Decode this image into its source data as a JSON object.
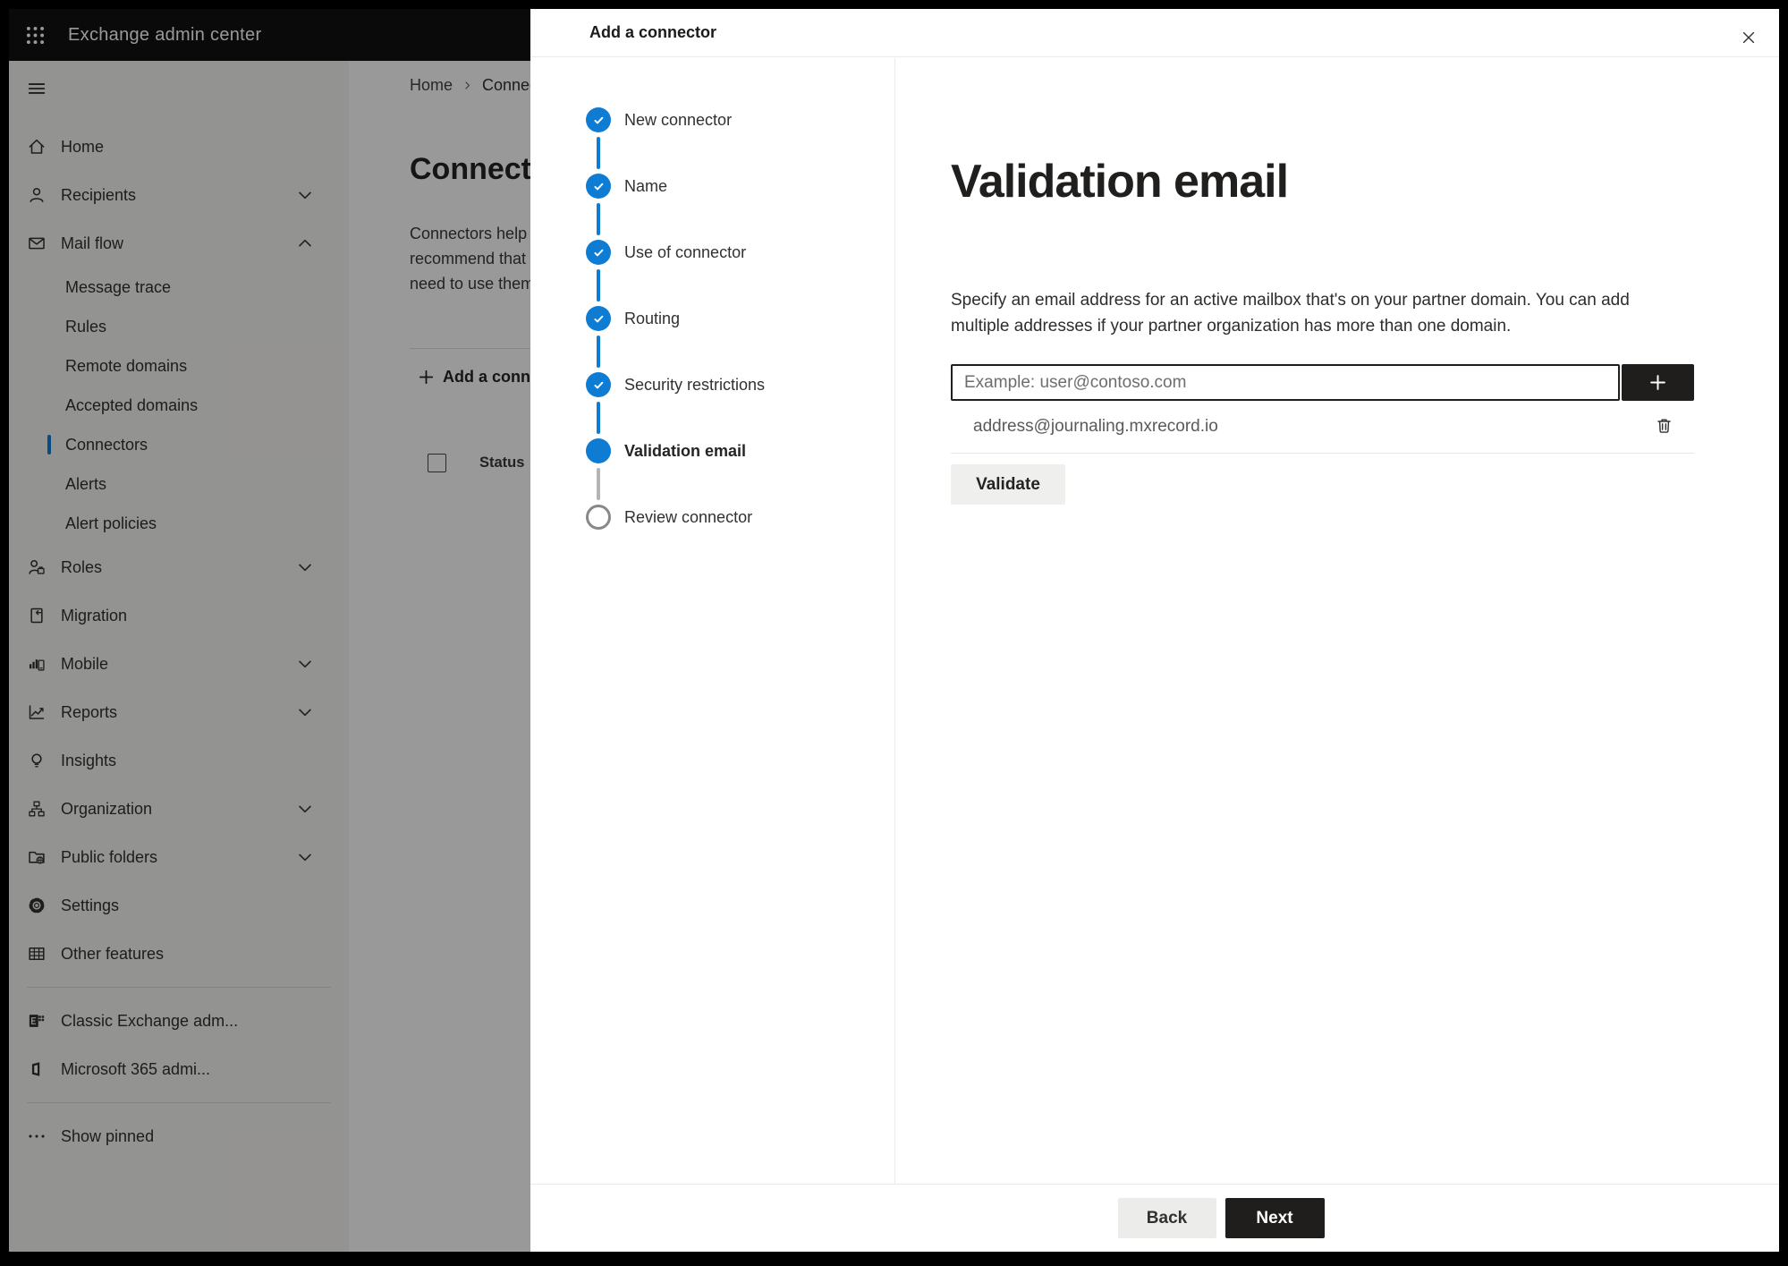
{
  "topbar": {
    "app_title": "Exchange admin center",
    "app_launcher_icon": "waffle"
  },
  "sidebar": {
    "menu_icon": "hamburger",
    "selected_item": "Connectors",
    "items": [
      {
        "label": "Home",
        "icon": "home"
      },
      {
        "label": "Recipients",
        "icon": "person",
        "chevron": "down"
      },
      {
        "label": "Mail flow",
        "icon": "mail",
        "chevron": "up",
        "children": [
          "Message trace",
          "Rules",
          "Remote domains",
          "Accepted domains",
          "Connectors",
          "Alerts",
          "Alert policies"
        ]
      },
      {
        "label": "Roles",
        "icon": "roles",
        "chevron": "down"
      },
      {
        "label": "Migration",
        "icon": "migration"
      },
      {
        "label": "Mobile",
        "icon": "mobile",
        "chevron": "down"
      },
      {
        "label": "Reports",
        "icon": "reports",
        "chevron": "down"
      },
      {
        "label": "Insights",
        "icon": "insights"
      },
      {
        "label": "Organization",
        "icon": "organization",
        "chevron": "down"
      },
      {
        "label": "Public folders",
        "icon": "public-folders",
        "chevron": "down"
      },
      {
        "label": "Settings",
        "icon": "gear"
      },
      {
        "label": "Other features",
        "icon": "table"
      },
      {
        "divider": true
      },
      {
        "label": "Classic Exchange adm...",
        "icon": "exchange-logo"
      },
      {
        "label": "Microsoft 365 admi...",
        "icon": "office-logo"
      },
      {
        "divider": true
      },
      {
        "label": "Show pinned",
        "icon": "ellipsis"
      }
    ]
  },
  "page": {
    "breadcrumb": {
      "home": "Home",
      "current": "Connectors",
      "separator_icon": "chevron-right"
    },
    "title": "Connectors",
    "description_lines": [
      "Connectors help",
      "recommend that",
      "need to use them"
    ],
    "add_button_label": "Add a connector",
    "add_button_icon": "plus",
    "table": {
      "status_column_label": "Status"
    }
  },
  "modal": {
    "title": "Add a connector",
    "close_icon": "close",
    "steps": [
      {
        "label": "New connector",
        "state": "complete"
      },
      {
        "label": "Name",
        "state": "complete"
      },
      {
        "label": "Use of connector",
        "state": "complete"
      },
      {
        "label": "Routing",
        "state": "complete"
      },
      {
        "label": "Security restrictions",
        "state": "complete"
      },
      {
        "label": "Validation email",
        "state": "current"
      },
      {
        "label": "Review connector",
        "state": "upcoming"
      }
    ],
    "content": {
      "heading": "Validation email",
      "description": "Specify an email address for an active mailbox that's on your partner domain. You can add multiple addresses if your partner organization has more than one domain.",
      "input_placeholder": "Example: user@contoso.com",
      "input_value": "",
      "add_icon": "plus",
      "addresses": [
        {
          "email": "address@journaling.mxrecord.io",
          "delete_icon": "trash"
        }
      ],
      "validate_button_label": "Validate"
    },
    "footer": {
      "back_label": "Back",
      "next_label": "Next"
    }
  },
  "colors": {
    "accent": "#0f7cd4",
    "topbar_bg": "#111111",
    "dark_button": "#1f1e1d",
    "step_pending_line": "#b6b4b2",
    "overlay": "rgba(0,0,0,0.40)"
  }
}
